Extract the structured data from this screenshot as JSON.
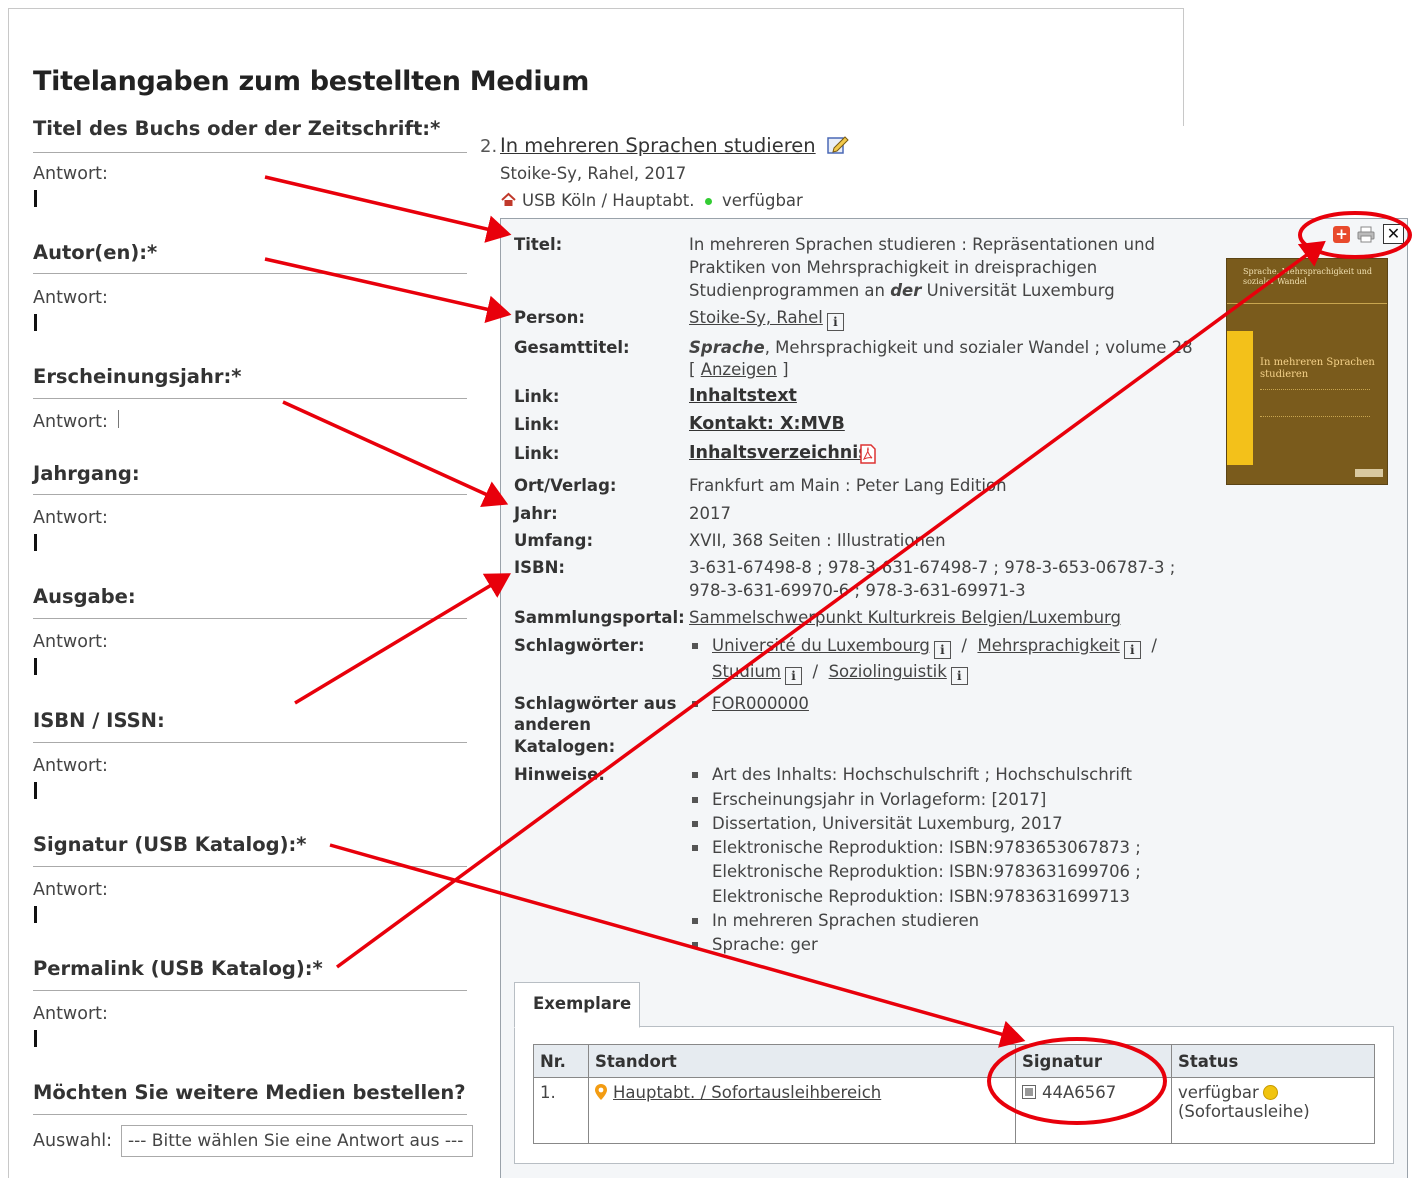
{
  "form": {
    "title": "Titelangaben zum bestellten Medium",
    "answer_label": "Antwort:",
    "questions": [
      {
        "label": "Titel des Buchs oder der Zeitschrift:*"
      },
      {
        "label": "Autor(en):*"
      },
      {
        "label": "Erscheinungsjahr:*"
      },
      {
        "label": "Jahrgang:"
      },
      {
        "label": "Ausgabe:"
      },
      {
        "label": "ISBN / ISSN:"
      },
      {
        "label": "Signatur (USB Katalog):*"
      },
      {
        "label": "Permalink (USB Katalog):*"
      }
    ],
    "more_question": "Möchten Sie weitere Medien bestellen?",
    "select_label": "Auswahl:",
    "select_value": "--- Bitte wählen Sie eine Antwort aus ---"
  },
  "result": {
    "number": "2.",
    "title": "In mehreren Sprachen studieren",
    "author_year": "Stoike-Sy, Rahel, 2017",
    "location": "USB Köln / Hauptabt.",
    "availability": "verfügbar"
  },
  "detail": {
    "labels": {
      "titel": "Titel:",
      "person": "Person:",
      "gesamttitel": "Gesamttitel:",
      "link": "Link:",
      "ort_verlag": "Ort/Verlag:",
      "jahr": "Jahr:",
      "umfang": "Umfang:",
      "isbn": "ISBN:",
      "sammlungsportal": "Sammlungsportal:",
      "schlagwoerter": "Schlagwörter:",
      "schlagwoerter_andere_1": "Schlagwörter aus",
      "schlagwoerter_andere_2": "anderen",
      "schlagwoerter_andere_3": "Katalogen:",
      "hinweise": "Hinweise:"
    },
    "titel_line1": "In mehreren Sprachen studieren : Repräsentationen und",
    "titel_line2": "Praktiken von Mehrsprachigkeit in dreisprachigen",
    "titel_line3_pre": "Studienprogrammen an ",
    "titel_line3_em": "der",
    "titel_line3_post": " Universität Luxemburg",
    "person": "Stoike-Sy, Rahel",
    "gesamttitel_em": "Sprache",
    "gesamttitel_rest": ", Mehrsprachigkeit und sozialer Wandel ; volume 28",
    "anzeigen_open": "[ ",
    "anzeigen": "Anzeigen",
    "anzeigen_close": " ]",
    "link1": "Inhaltstext",
    "link2": "Kontakt: X:MVB",
    "link3": "Inhaltsverzeichnis",
    "ort_verlag": "Frankfurt am Main : Peter Lang Edition",
    "jahr": "2017",
    "umfang": "XVII, 368 Seiten : Illustrationen",
    "isbn_line1": "3-631-67498-8 ; 978-3-631-67498-7 ; 978-3-653-06787-3 ;",
    "isbn_line2": "978-3-631-69970-6 ; 978-3-631-69971-3",
    "sammlungsportal": "Sammelschwerpunkt Kulturkreis Belgien/Luxemburg",
    "schlagwort1": "Université du Luxembourg",
    "schlagwort2": "Mehrsprachigkeit",
    "schlagwort3": "Studium",
    "schlagwort4": "Soziolinguistik",
    "separator": "/",
    "schlagwort_andere": "FOR000000",
    "hinweise": [
      "Art des Inhalts: Hochschulschrift ; Hochschulschrift",
      "Erscheinungsjahr in Vorlageform: [2017]",
      "Dissertation, Universität Luxemburg, 2017",
      "Elektronische Reproduktion: ISBN:9783653067873 ;",
      "Elektronische Reproduktion: ISBN:9783631699706 ;",
      "Elektronische Reproduktion: ISBN:9783631699713",
      "In mehreren Sprachen studieren",
      "Sprache: ger"
    ],
    "cover_top": "Sprache, Mehrsprachigkeit und sozialer Wandel",
    "cover_title": "In mehreren Sprachen studieren"
  },
  "exemplare": {
    "tab": "Exemplare",
    "headers": [
      "Nr.",
      "Standort",
      "Signatur",
      "Status"
    ],
    "row": {
      "nr": "1.",
      "standort": "Hauptabt. / Sofortausleihbereich",
      "signatur": "44A6567",
      "status_line1": "verfügbar",
      "status_line2": "(Sofortausleihe)"
    }
  },
  "colors": {
    "annotation_red": "#e8000b",
    "cover_brown": "#7a5b1c",
    "cover_yellow": "#f3c11a"
  }
}
